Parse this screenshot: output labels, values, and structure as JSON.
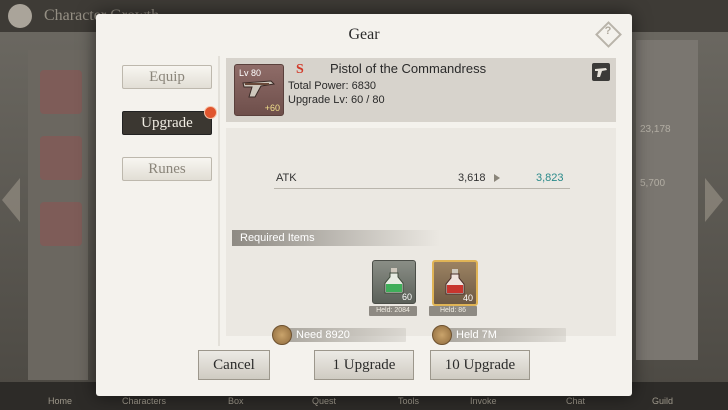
{
  "background": {
    "title": "Character Growth",
    "right_values": [
      "23,178",
      "5,700"
    ],
    "bottom_nav": [
      "Home",
      "Characters",
      "Box",
      "Quest",
      "Tools",
      "Invoke",
      "Chat",
      "Guild"
    ]
  },
  "dialog": {
    "title": "Gear",
    "help_icon": "help-diamond-icon"
  },
  "tabs": [
    {
      "label": "Equip",
      "active": false
    },
    {
      "label": "Upgrade",
      "active": true,
      "has_notification": true
    },
    {
      "label": "Runes",
      "active": false
    }
  ],
  "item": {
    "level": "Lv 80",
    "plus": "+60",
    "rank": "S",
    "name": "Pistol of the Commandress",
    "total_power": "Total Power: 6830",
    "upgrade_level": "Upgrade Lv: 60 / 80",
    "icon": "pistol-icon",
    "type_icon": "pistol-type-icon"
  },
  "stats": [
    {
      "label": "ATK",
      "current": "3,618",
      "next": "3,823"
    }
  ],
  "required": {
    "label": "Required Items",
    "materials": [
      {
        "icon": "green-potion-icon",
        "count": "60",
        "held": "Held: 2084"
      },
      {
        "icon": "red-potion-icon",
        "count": "40",
        "held": "Held: 86"
      }
    ],
    "need": "Need 8920",
    "held": "Held  7M"
  },
  "buttons": {
    "cancel": "Cancel",
    "upgrade_1": "1 Upgrade",
    "upgrade_10": "10 Upgrade"
  },
  "colors": {
    "rank": "#d23a2a",
    "stat_next": "#2a8a8a",
    "notification": "#e0552e"
  }
}
